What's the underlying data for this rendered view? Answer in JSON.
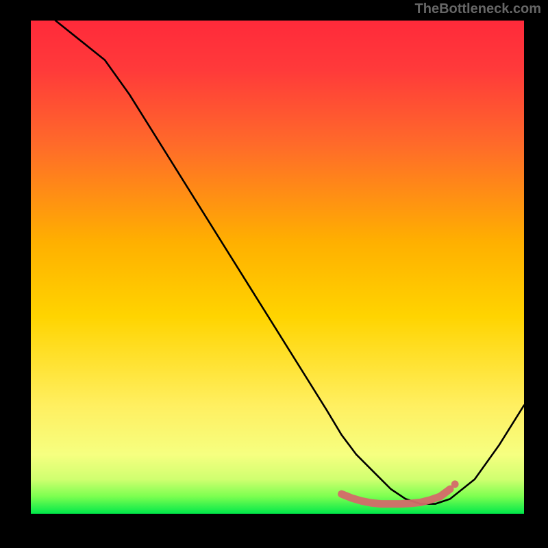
{
  "watermark": "TheBottleneck.com",
  "colors": {
    "accent_top": "#ff2a3a",
    "accent_mid": "#ffd400",
    "accent_low": "#fff59a",
    "accent_bottom": "#00e84a",
    "line": "#000000",
    "marker": "#d46a6a",
    "plot_border": "#000000",
    "page_bg": "#000000",
    "watermark_color": "#666666"
  },
  "chart_data": {
    "type": "line",
    "title": "",
    "xlabel": "",
    "ylabel": "",
    "xlim": [
      0,
      100
    ],
    "ylim": [
      0,
      100
    ],
    "grid": false,
    "legend": null,
    "series": [
      {
        "name": "curve",
        "x": [
          5,
          10,
          15,
          20,
          25,
          30,
          35,
          40,
          45,
          50,
          55,
          60,
          63,
          66,
          70,
          73,
          76,
          79,
          82,
          85,
          90,
          95,
          100
        ],
        "y": [
          100,
          96,
          92,
          85,
          77,
          69,
          61,
          53,
          45,
          37,
          29,
          21,
          16,
          12,
          8,
          5,
          3,
          2,
          2,
          3,
          7,
          14,
          22
        ]
      }
    ],
    "markers": {
      "name": "bottom-cluster",
      "x": [
        63,
        65,
        67,
        69,
        71,
        73,
        75,
        77,
        79,
        81,
        83,
        85
      ],
      "y": [
        4,
        3.2,
        2.6,
        2.2,
        2,
        2,
        2,
        2.1,
        2.3,
        2.8,
        3.5,
        5
      ],
      "color": "#d46a6a",
      "radius": 3.3
    },
    "gradient_stops": [
      {
        "offset": 0.0,
        "color": "#ff2a3a"
      },
      {
        "offset": 0.1,
        "color": "#ff3a3a"
      },
      {
        "offset": 0.25,
        "color": "#ff6a2a"
      },
      {
        "offset": 0.45,
        "color": "#ffb000"
      },
      {
        "offset": 0.6,
        "color": "#ffd400"
      },
      {
        "offset": 0.78,
        "color": "#ffef60"
      },
      {
        "offset": 0.88,
        "color": "#f6ff80"
      },
      {
        "offset": 0.93,
        "color": "#d0ff70"
      },
      {
        "offset": 0.965,
        "color": "#7cff50"
      },
      {
        "offset": 1.0,
        "color": "#00e84a"
      }
    ]
  }
}
